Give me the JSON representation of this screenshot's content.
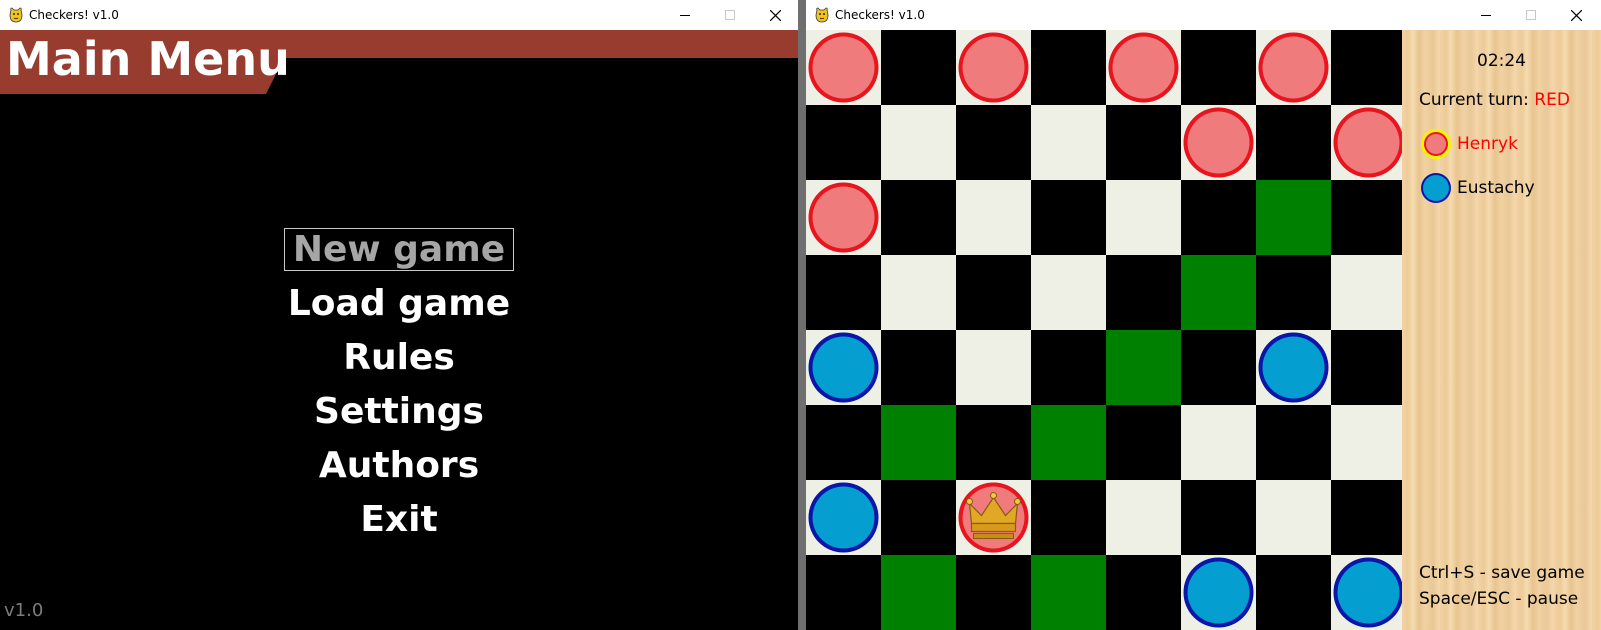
{
  "menu_window": {
    "title": "Checkers! v1.0",
    "heading": "Main Menu",
    "items": [
      {
        "label": "New game",
        "selected": true
      },
      {
        "label": "Load game",
        "selected": false
      },
      {
        "label": "Rules",
        "selected": false
      },
      {
        "label": "Settings",
        "selected": false
      },
      {
        "label": "Authors",
        "selected": false
      },
      {
        "label": "Exit",
        "selected": false
      }
    ],
    "version": "v1.0",
    "banner_color": "#983c30"
  },
  "game_window": {
    "title": "Checkers! v1.0",
    "timer": "02:24",
    "turn_label": "Current turn: ",
    "turn_value": "RED",
    "players": [
      {
        "name": "Henryk",
        "color": "red",
        "active": true
      },
      {
        "name": "Eustachy",
        "color": "blue",
        "active": false
      }
    ],
    "help": [
      "Ctrl+S - save game",
      "Space/ESC - pause"
    ],
    "board": {
      "size": 8,
      "highlighted": [
        [
          2,
          6
        ],
        [
          3,
          5
        ],
        [
          4,
          4
        ],
        [
          5,
          1
        ],
        [
          5,
          3
        ],
        [
          7,
          1
        ],
        [
          7,
          3
        ]
      ],
      "pieces": [
        {
          "row": 0,
          "col": 0,
          "color": "red",
          "king": false
        },
        {
          "row": 0,
          "col": 2,
          "color": "red",
          "king": false
        },
        {
          "row": 0,
          "col": 4,
          "color": "red",
          "king": false
        },
        {
          "row": 0,
          "col": 6,
          "color": "red",
          "king": false
        },
        {
          "row": 1,
          "col": 5,
          "color": "red",
          "king": false
        },
        {
          "row": 1,
          "col": 7,
          "color": "red",
          "king": false
        },
        {
          "row": 2,
          "col": 0,
          "color": "red",
          "king": false
        },
        {
          "row": 4,
          "col": 0,
          "color": "blue",
          "king": false
        },
        {
          "row": 4,
          "col": 6,
          "color": "blue",
          "king": false
        },
        {
          "row": 6,
          "col": 0,
          "color": "blue",
          "king": false
        },
        {
          "row": 6,
          "col": 2,
          "color": "red",
          "king": true
        },
        {
          "row": 7,
          "col": 5,
          "color": "blue",
          "king": false
        },
        {
          "row": 7,
          "col": 7,
          "color": "blue",
          "king": false
        }
      ]
    },
    "colors": {
      "light_square": "#eef0e6",
      "dark_square": "#000000",
      "highlight_square": "#008000",
      "red_fill": "#f07b7d",
      "red_ring": "#e8141e",
      "blue_fill": "#049ed1",
      "blue_ring": "#0a16a8",
      "active_player_ring": "#f5f500"
    }
  }
}
